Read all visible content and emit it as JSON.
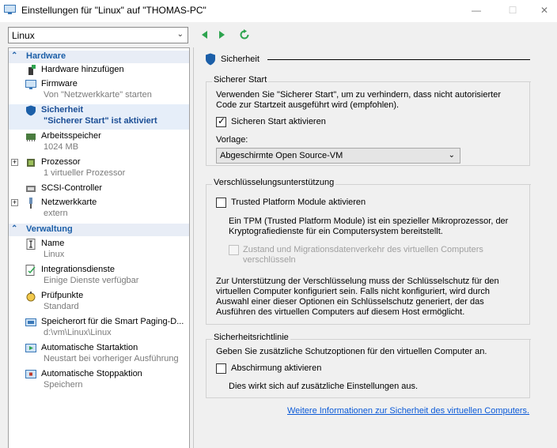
{
  "window": {
    "title": "Einstellungen für \"Linux\" auf \"THOMAS-PC\"",
    "minimize_glyph": "—",
    "maximize_glyph": "☐",
    "close_glyph": "✕"
  },
  "vm_selector": {
    "value": "Linux"
  },
  "toolbar": {
    "icons": [
      "back-arrow-icon",
      "forward-arrow-icon",
      "refresh-icon"
    ]
  },
  "sidebar": {
    "hardware_label": "Hardware",
    "management_label": "Verwaltung",
    "items": [
      {
        "label": "Hardware hinzufügen",
        "sub": "",
        "icon": "add-hardware-icon"
      },
      {
        "label": "Firmware",
        "sub": "Von \"Netzwerkkarte\" starten",
        "icon": "firmware-icon"
      },
      {
        "label": "Sicherheit",
        "sub": "\"Sicherer Start\" ist aktiviert",
        "icon": "shield-icon",
        "selected": true
      },
      {
        "label": "Arbeitsspeicher",
        "sub": "1024 MB",
        "icon": "memory-icon"
      },
      {
        "label": "Prozessor",
        "sub": "1 virtueller Prozessor",
        "icon": "processor-icon",
        "expandable": true
      },
      {
        "label": "SCSI-Controller",
        "sub": "",
        "icon": "scsi-controller-icon"
      },
      {
        "label": "Netzwerkkarte",
        "sub": "extern",
        "icon": "network-adapter-icon",
        "expandable": true
      },
      {
        "label": "Name",
        "sub": "Linux",
        "icon": "name-icon"
      },
      {
        "label": "Integrationsdienste",
        "sub": "Einige Dienste verfügbar",
        "icon": "integration-services-icon"
      },
      {
        "label": "Prüfpunkte",
        "sub": "Standard",
        "icon": "checkpoints-icon"
      },
      {
        "label": "Speicherort für die Smart Paging-D...",
        "sub": "d:\\vm\\Linux\\Linux",
        "icon": "smart-paging-icon"
      },
      {
        "label": "Automatische Startaktion",
        "sub": "Neustart bei vorheriger Ausführung",
        "icon": "auto-start-icon"
      },
      {
        "label": "Automatische Stoppaktion",
        "sub": "Speichern",
        "icon": "auto-stop-icon"
      }
    ]
  },
  "security": {
    "title": "Sicherheit",
    "secure_boot": {
      "group_label": "Sicherer Start",
      "desc_line1": "Verwenden Sie \"Sicherer Start\", um zu verhindern, dass nicht autorisierter",
      "desc_line2": "Code zur Startzeit ausgeführt wird (empfohlen).",
      "checkbox_label": "Sicheren Start aktivieren",
      "checked": true,
      "template_label": "Vorlage:",
      "template_value": "Abgeschirmte Open Source-VM"
    },
    "encryption": {
      "group_label": "Verschlüsselungsunterstützung",
      "tpm_label": "Trusted Platform Module aktivieren",
      "tpm_checked": false,
      "tpm_desc_line1": "Ein TPM (Trusted Platform Module) ist ein spezieller Mikroprozessor, der",
      "tpm_desc_line2": "Kryptografiedienste für ein Computersystem bereitstellt.",
      "encrypt_label_line1": "Zustand und Migrationsdatenverkehr des virtuellen Computers",
      "encrypt_label_line2": "verschlüsseln",
      "encrypt_checked": false,
      "note_line1": "Zur Unterstützung der Verschlüsselung muss der Schlüsselschutz für den",
      "note_line2": "virtuellen Computer konfiguriert sein. Falls nicht konfiguriert, wird durch",
      "note_line3": "Auswahl einer dieser Optionen ein Schlüsselschutz generiert, der das",
      "note_line4": "Ausführen des virtuellen Computers auf diesem Host ermöglicht."
    },
    "policy": {
      "group_label": "Sicherheitsrichtlinie",
      "desc": "Geben Sie zusätzliche Schutzoptionen für den virtuellen Computer an.",
      "shielding_label": "Abschirmung aktivieren",
      "shielding_checked": false,
      "shielding_desc": "Dies wirkt sich auf zusätzliche Einstellungen aus."
    },
    "more_info_link": "Weitere Informationen zur Sicherheit des virtuellen Computers."
  },
  "colors": {
    "accent": "#1c5fa8",
    "link": "#0b5ad8",
    "selected_bg": "#e6eef9"
  }
}
